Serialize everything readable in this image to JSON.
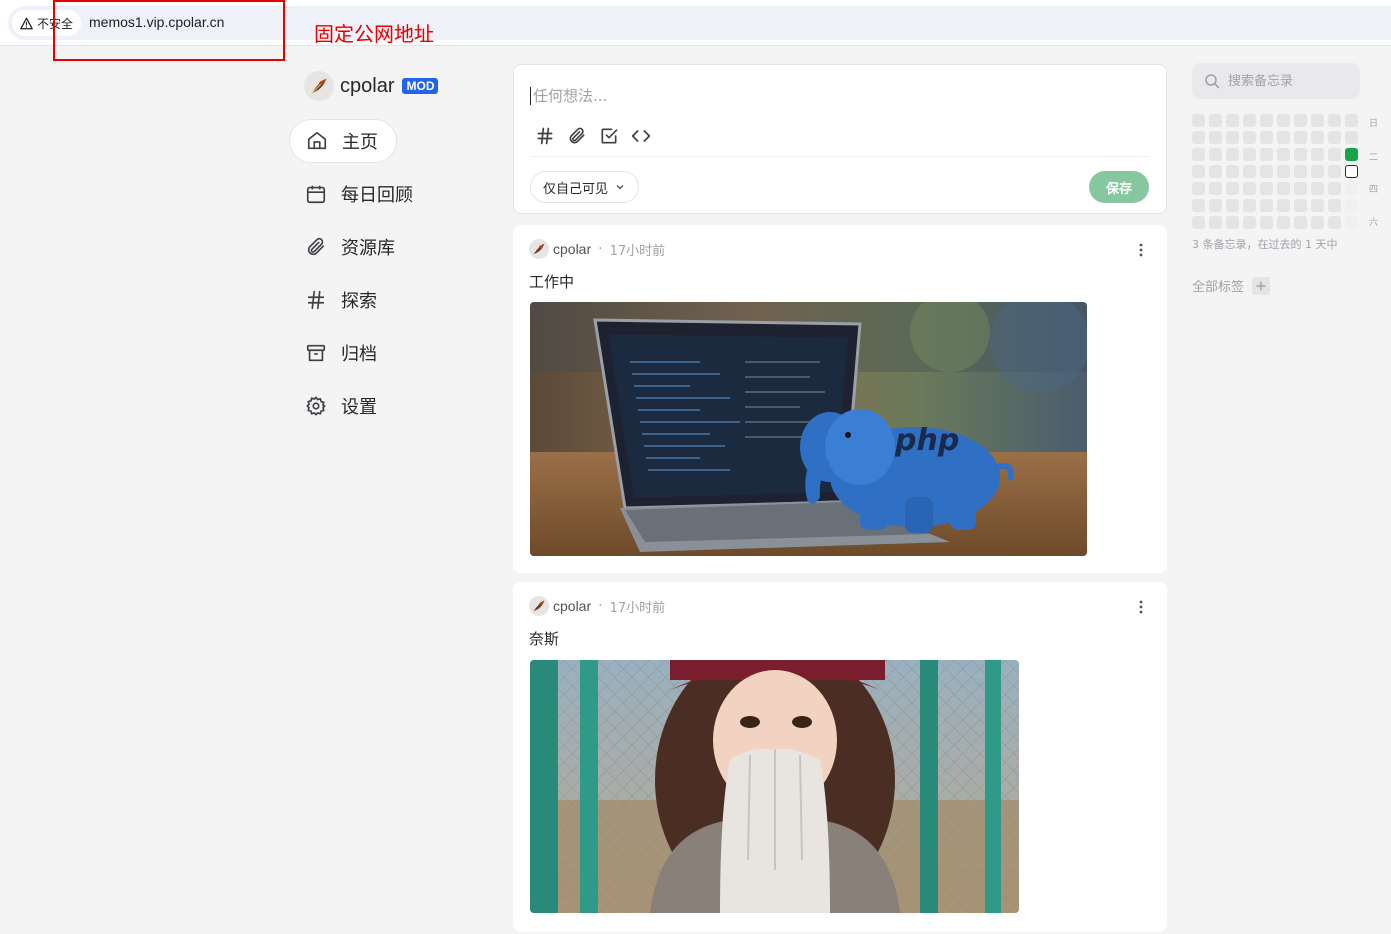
{
  "browser": {
    "security_label": "不安全",
    "url": "memos1.vip.cpolar.cn",
    "annotation": "固定公网地址",
    "annotation_color": "#e60000"
  },
  "brand": {
    "name": "cpolar",
    "badge": "MOD",
    "badge_color": "#2563eb",
    "avatar_icon": "feather-icon"
  },
  "nav": {
    "items": [
      {
        "label": "主页",
        "icon": "home-icon",
        "active": true
      },
      {
        "label": "每日回顾",
        "icon": "calendar-icon",
        "active": false
      },
      {
        "label": "资源库",
        "icon": "paperclip-icon",
        "active": false
      },
      {
        "label": "探索",
        "icon": "hash-icon",
        "active": false
      },
      {
        "label": "归档",
        "icon": "archive-icon",
        "active": false
      },
      {
        "label": "设置",
        "icon": "gear-icon",
        "active": false
      }
    ]
  },
  "editor": {
    "placeholder": "任何想法...",
    "tools": [
      "hash-icon",
      "paperclip-icon",
      "checkbox-icon",
      "code-icon"
    ],
    "visibility": "仅自己可见",
    "save_label": "保存",
    "save_color": "#86c79f"
  },
  "memos": [
    {
      "author": "cpolar",
      "time": "17小时前",
      "content": "工作中",
      "image": "laptop-with-php-elephant"
    },
    {
      "author": "cpolar",
      "time": "17小时前",
      "content": "奈斯",
      "image": "woman-with-gloves-outdoor"
    }
  ],
  "sidebar_right": {
    "search_placeholder": "搜索备忘录",
    "weekdays": [
      "日",
      "二",
      "四",
      "六"
    ],
    "stat": "3 条备忘录，在过去的 1 天中",
    "tags_title": "全部标签",
    "heatmap_color": "#16a34a"
  }
}
